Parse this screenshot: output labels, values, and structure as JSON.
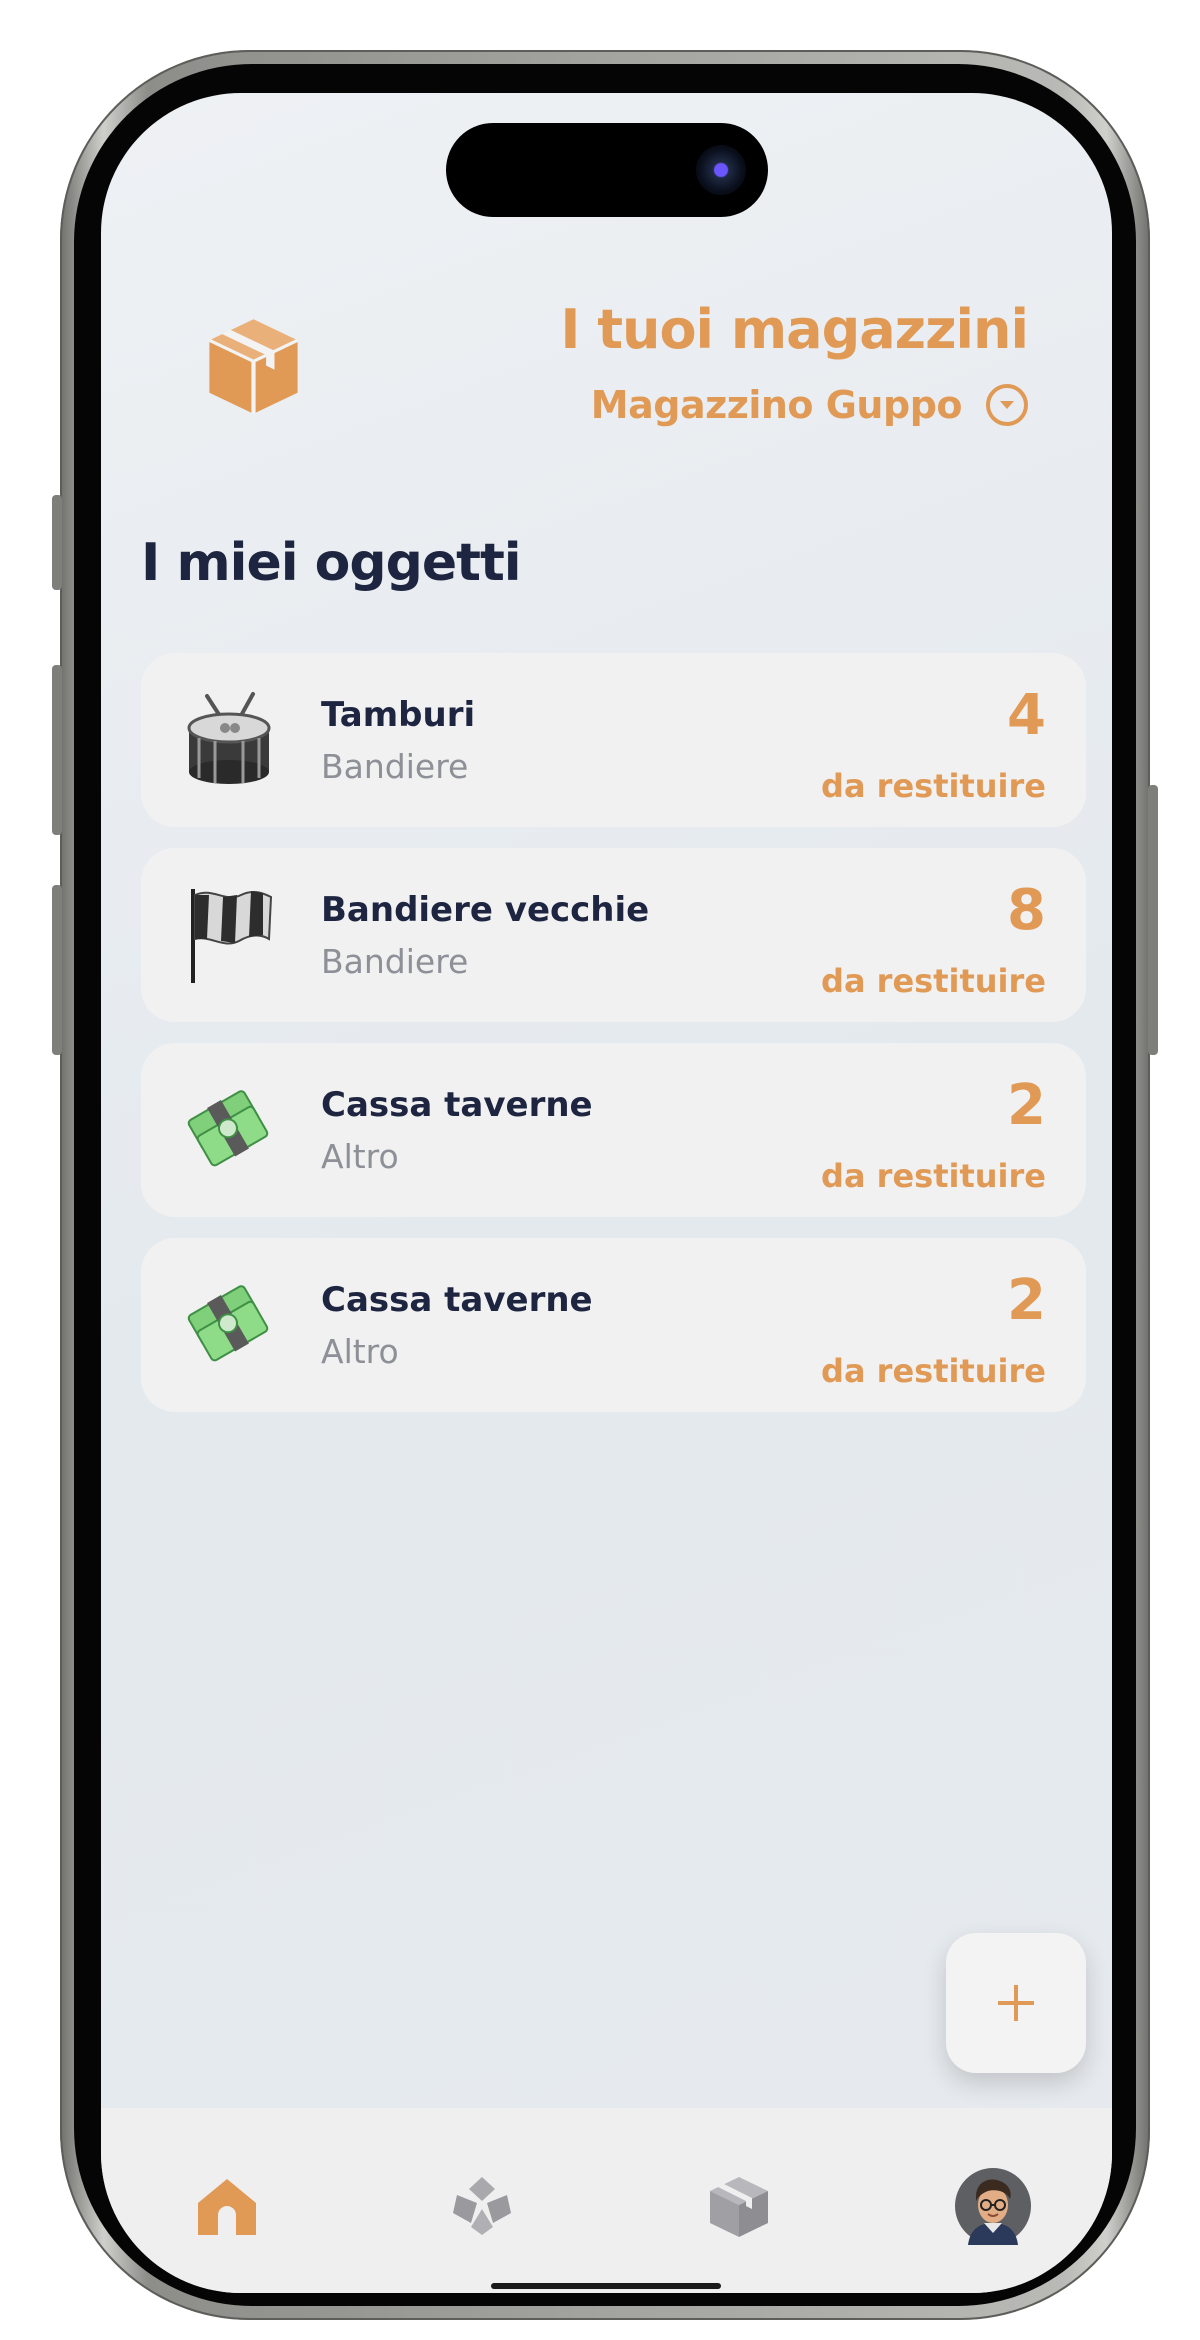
{
  "header": {
    "title": "I tuoi magazzini",
    "store_name": "Magazzino Guppo"
  },
  "section_title": "I miei oggetti",
  "items": [
    {
      "name": "Tamburi",
      "category": "Bandiere",
      "count": "4",
      "status": "da restituire",
      "icon": "drum-icon"
    },
    {
      "name": "Bandiere vecchie",
      "category": "Bandiere",
      "count": "8",
      "status": "da restituire",
      "icon": "flag-icon"
    },
    {
      "name": "Cassa taverne",
      "category": "Altro",
      "count": "2",
      "status": "da restituire",
      "icon": "money-icon"
    },
    {
      "name": "Cassa taverne",
      "category": "Altro",
      "count": "2",
      "status": "da restituire",
      "icon": "money-icon"
    }
  ],
  "fab_label": "+",
  "nav": [
    "home-icon",
    "categories-icon",
    "box-icon",
    "profile-avatar"
  ],
  "colors": {
    "accent": "#e09a55",
    "dark_text": "#1e2540",
    "muted_text": "#8e9097",
    "card_bg": "#f1f1f2"
  }
}
